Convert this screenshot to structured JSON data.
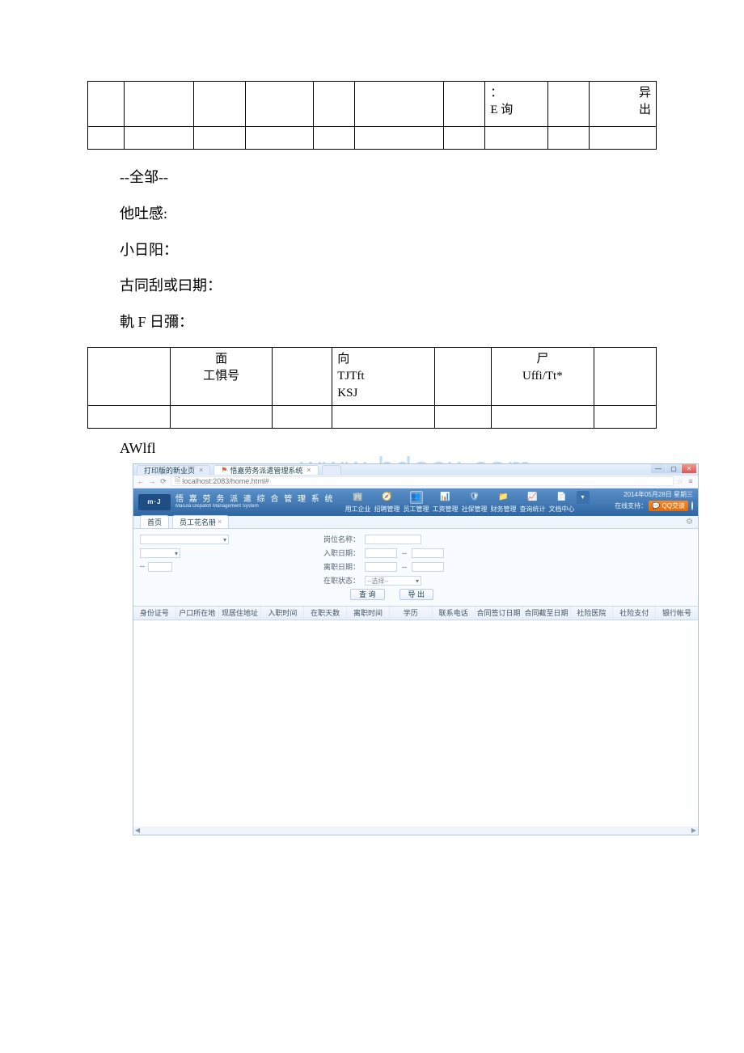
{
  "table1": {
    "row1_col8": "：\nE 询",
    "row1_col10": "异\n出"
  },
  "paras": {
    "p1": "--全邹--",
    "p2": "他吐感:",
    "p3": "小日阳：",
    "p4": "古同刮或曰期：",
    "p5": "軌 F 日彌："
  },
  "table2": {
    "c2": "面\n工惧号",
    "c4": "向\nTJTft\nKSJ",
    "c6": "尸\nUffi/Tt*"
  },
  "text_after": "AWlfl",
  "watermark": "www bdocx com",
  "app": {
    "browser_tabs": {
      "t1": "打印版的新业页",
      "t2": "悟嘉劳务派遣管理系统"
    },
    "win_ctrl": {
      "min": "—",
      "max": "▢",
      "close": "✕"
    },
    "url_prefix": "🗎",
    "url": "localhost:2083/home.html#",
    "star": "☆",
    "hamburger": "≡",
    "nav": {
      "back": "←",
      "fwd": "→",
      "reload": "⟳"
    },
    "logo_small": "m·J",
    "logo_cn": "悟 嘉 劳 务 派 遣 综 合 管 理 系 统",
    "logo_en": "MaoJia Dispatch Management System",
    "menus": [
      {
        "label": "用工企业",
        "glyph": "🏢"
      },
      {
        "label": "招聘管理",
        "glyph": "🧭"
      },
      {
        "label": "员工管理",
        "glyph": "👥"
      },
      {
        "label": "工资管理",
        "glyph": "📊"
      },
      {
        "label": "社保管理",
        "glyph": "🛡"
      },
      {
        "label": "财务管理",
        "glyph": "📁"
      },
      {
        "label": "查询统计",
        "glyph": "📈"
      },
      {
        "label": "文档中心",
        "glyph": "📄"
      }
    ],
    "dropdown_glyph": "▾",
    "date_text": "2014年05月28日 星期三",
    "online_label": "在线支持：",
    "qq_label": "💬 QQ交谈",
    "power_aria": "power",
    "subtabs": {
      "t1": "首页",
      "t2": "员工花名册",
      "close": "×"
    },
    "gear": "⚙",
    "filters": {
      "lbl_post": "岗位名称：",
      "lbl_in": "入职日期：",
      "lbl_out": "离职日期：",
      "lbl_onjob": "在职状态：",
      "to": "--",
      "onjob_val": "--选择--",
      "btn_query": "查 询",
      "btn_export": "导 出"
    },
    "columns": [
      "身份证号",
      "户口所在地",
      "现居住地址",
      "入职时间",
      "在职天数",
      "离职时间",
      "学历",
      "联系电话",
      "合同签订日期",
      "合同截至日期",
      "社险医院",
      "社险支付",
      "银行帐号"
    ],
    "scroll": {
      "left": "◀",
      "right": "▶"
    }
  }
}
